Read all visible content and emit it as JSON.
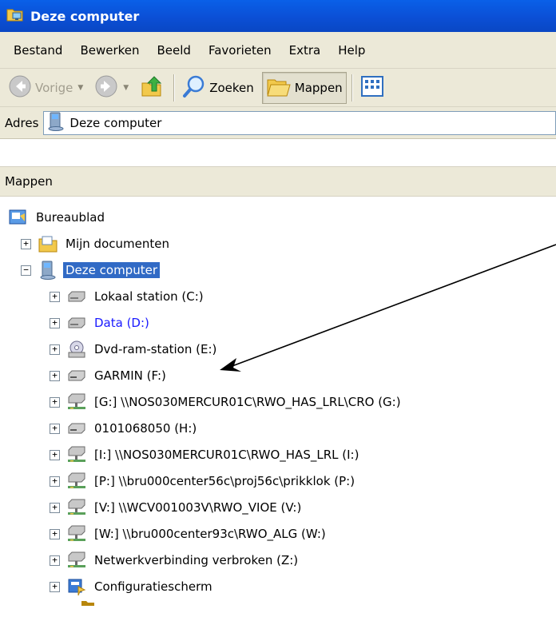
{
  "window": {
    "title": "Deze computer",
    "title_icon": "folder-computer-icon"
  },
  "menubar": {
    "items": [
      "Bestand",
      "Bewerken",
      "Beeld",
      "Favorieten",
      "Extra",
      "Help"
    ]
  },
  "toolbar": {
    "back_label": "Vorige",
    "search_label": "Zoeken",
    "folders_label": "Mappen"
  },
  "address": {
    "label": "Adres",
    "value": "Deze computer"
  },
  "folders_pane": {
    "header": "Mappen"
  },
  "tree": {
    "root": {
      "label": "Bureaublad",
      "icon": "desktop-icon"
    },
    "my_documents": {
      "label": "Mijn documenten",
      "icon": "documents-folder-icon"
    },
    "my_computer": {
      "label": "Deze computer",
      "icon": "computer-icon"
    },
    "drives": [
      {
        "label": "Lokaal station (C:)",
        "icon": "hard-drive-icon"
      },
      {
        "label": "Data (D:)",
        "icon": "hard-drive-icon"
      },
      {
        "label": "Dvd-ram-station (E:)",
        "icon": "dvd-drive-icon"
      },
      {
        "label": "GARMIN (F:)",
        "icon": "removable-drive-icon"
      },
      {
        "label": "[G:] \\\\NOS030MERCUR01C\\RWO_HAS_LRL\\CRO (G:)",
        "icon": "network-drive-icon"
      },
      {
        "label": "0101068050 (H:)",
        "icon": "removable-drive-icon"
      },
      {
        "label": "[I:] \\\\NOS030MERCUR01C\\RWO_HAS_LRL (I:)",
        "icon": "network-drive-icon"
      },
      {
        "label": "[P:] \\\\bru000center56c\\proj56c\\prikklok (P:)",
        "icon": "network-drive-icon"
      },
      {
        "label": "[V:] \\\\WCV001003V\\RWO_VIOE (V:)",
        "icon": "network-drive-icon"
      },
      {
        "label": "[W:] \\\\bru000center93c\\RWO_ALG (W:)",
        "icon": "network-drive-icon"
      },
      {
        "label": "Netwerkverbinding verbroken (Z:)",
        "icon": "network-drive-icon"
      },
      {
        "label": "Configuratiescherm",
        "icon": "control-panel-icon"
      }
    ]
  },
  "colors": {
    "titlebar": "#0a4fd6",
    "chrome": "#ece9d8",
    "selection": "#316ac5",
    "link_blue": "#1a1aff"
  }
}
